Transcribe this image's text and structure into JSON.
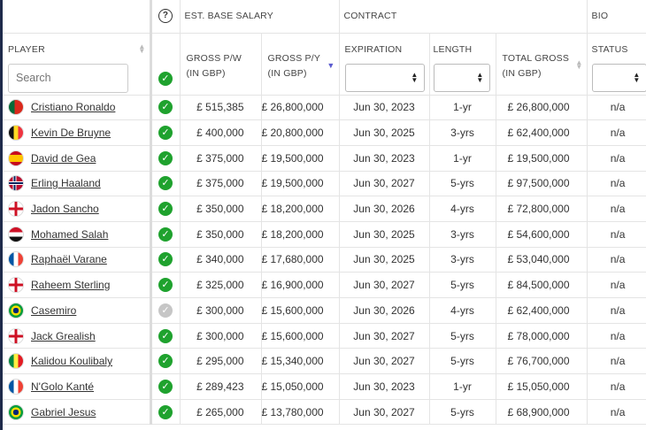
{
  "header": {
    "groups": {
      "salary": "EST. BASE SALARY",
      "contract": "CONTRACT",
      "bio": "BIO",
      "help_icon_text": "?"
    },
    "columns": {
      "player": "PLAYER",
      "gross_pw_line1": "GROSS P/W",
      "gross_pw_line2": "(IN GBP)",
      "gross_py_line1": "GROSS P/Y",
      "gross_py_line2": "(IN GBP)",
      "expiration": "EXPIRATION",
      "length": "LENGTH",
      "total_line1": "TOTAL GROSS",
      "total_line2": "(IN GBP)",
      "status": "STATUS"
    },
    "search_placeholder": "Search"
  },
  "rows": [
    {
      "flag": "portugal",
      "name": "Cristiano Ronaldo",
      "verified": true,
      "gross_pw": "£ 515,385",
      "gross_py": "£ 26,800,000",
      "expiration": "Jun 30, 2023",
      "length": "1-yr",
      "total": "£ 26,800,000",
      "status": "n/a"
    },
    {
      "flag": "belgium",
      "name": "Kevin De Bruyne",
      "verified": true,
      "gross_pw": "£ 400,000",
      "gross_py": "£ 20,800,000",
      "expiration": "Jun 30, 2025",
      "length": "3-yrs",
      "total": "£ 62,400,000",
      "status": "n/a"
    },
    {
      "flag": "spain",
      "name": "David de Gea",
      "verified": true,
      "gross_pw": "£ 375,000",
      "gross_py": "£ 19,500,000",
      "expiration": "Jun 30, 2023",
      "length": "1-yr",
      "total": "£ 19,500,000",
      "status": "n/a"
    },
    {
      "flag": "norway",
      "name": "Erling Haaland",
      "verified": true,
      "gross_pw": "£ 375,000",
      "gross_py": "£ 19,500,000",
      "expiration": "Jun 30, 2027",
      "length": "5-yrs",
      "total": "£ 97,500,000",
      "status": "n/a"
    },
    {
      "flag": "england",
      "name": "Jadon Sancho",
      "verified": true,
      "gross_pw": "£ 350,000",
      "gross_py": "£ 18,200,000",
      "expiration": "Jun 30, 2026",
      "length": "4-yrs",
      "total": "£ 72,800,000",
      "status": "n/a"
    },
    {
      "flag": "egypt",
      "name": "Mohamed Salah",
      "verified": true,
      "gross_pw": "£ 350,000",
      "gross_py": "£ 18,200,000",
      "expiration": "Jun 30, 2025",
      "length": "3-yrs",
      "total": "£ 54,600,000",
      "status": "n/a"
    },
    {
      "flag": "france",
      "name": "Raphaël Varane",
      "verified": true,
      "gross_pw": "£ 340,000",
      "gross_py": "£ 17,680,000",
      "expiration": "Jun 30, 2025",
      "length": "3-yrs",
      "total": "£ 53,040,000",
      "status": "n/a"
    },
    {
      "flag": "england",
      "name": "Raheem Sterling",
      "verified": true,
      "gross_pw": "£ 325,000",
      "gross_py": "£ 16,900,000",
      "expiration": "Jun 30, 2027",
      "length": "5-yrs",
      "total": "£ 84,500,000",
      "status": "n/a"
    },
    {
      "flag": "brazil",
      "name": "Casemiro",
      "verified": false,
      "gross_pw": "£ 300,000",
      "gross_py": "£ 15,600,000",
      "expiration": "Jun 30, 2026",
      "length": "4-yrs",
      "total": "£ 62,400,000",
      "status": "n/a"
    },
    {
      "flag": "england",
      "name": "Jack Grealish",
      "verified": true,
      "gross_pw": "£ 300,000",
      "gross_py": "£ 15,600,000",
      "expiration": "Jun 30, 2027",
      "length": "5-yrs",
      "total": "£ 78,000,000",
      "status": "n/a"
    },
    {
      "flag": "senegal",
      "name": "Kalidou Koulibaly",
      "verified": true,
      "gross_pw": "£ 295,000",
      "gross_py": "£ 15,340,000",
      "expiration": "Jun 30, 2027",
      "length": "5-yrs",
      "total": "£ 76,700,000",
      "status": "n/a"
    },
    {
      "flag": "france",
      "name": "N'Golo Kanté",
      "verified": true,
      "gross_pw": "£ 289,423",
      "gross_py": "£ 15,050,000",
      "expiration": "Jun 30, 2023",
      "length": "1-yr",
      "total": "£ 15,050,000",
      "status": "n/a"
    },
    {
      "flag": "brazil",
      "name": "Gabriel Jesus",
      "verified": true,
      "gross_pw": "£ 265,000",
      "gross_py": "£ 13,780,000",
      "expiration": "Jun 30, 2027",
      "length": "5-yrs",
      "total": "£ 68,900,000",
      "status": "n/a"
    }
  ]
}
